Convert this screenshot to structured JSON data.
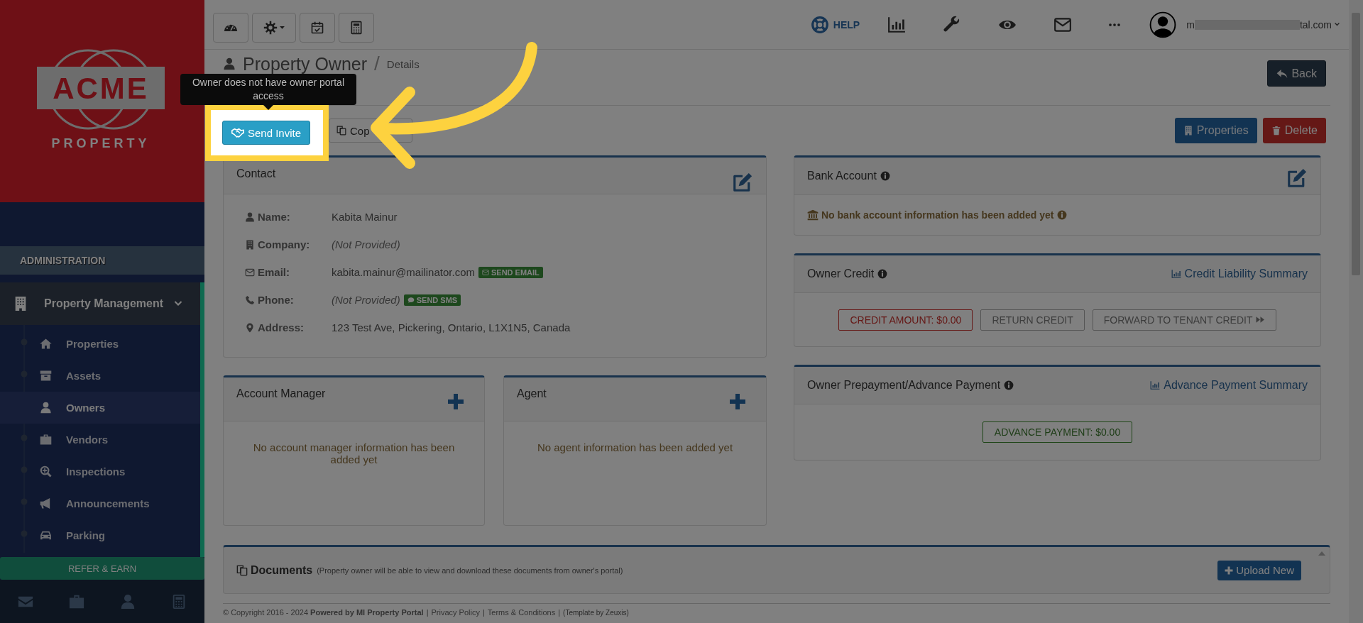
{
  "sidebar": {
    "logo": {
      "word": "ACME",
      "tagline": "PROPERTY"
    },
    "section": "ADMINISTRATION",
    "group": {
      "label": "Property Management",
      "expanded": true,
      "items": [
        {
          "label": "Properties",
          "selected": false
        },
        {
          "label": "Assets",
          "selected": false
        },
        {
          "label": "Owners",
          "selected": true
        },
        {
          "label": "Vendors",
          "selected": false
        },
        {
          "label": "Inspections",
          "selected": false
        },
        {
          "label": "Announcements",
          "selected": false
        },
        {
          "label": "Parking",
          "selected": false
        }
      ]
    },
    "refer": "REFER & EARN"
  },
  "topbar": {
    "help": "HELP",
    "user": {
      "email_start": "m",
      "email_end": "tal.com"
    }
  },
  "header": {
    "title": "Property Owner",
    "separator": "/",
    "subtitle": "Details",
    "back": "Back"
  },
  "tooltip": "Owner does not have owner portal access",
  "actions": {
    "send_invite": "Send Invite",
    "copy": "Cop",
    "properties": "Properties",
    "delete": "Delete"
  },
  "contact": {
    "title": "Contact",
    "fields": [
      {
        "label": "Name:",
        "value": "Kabita Mainur",
        "empty": false
      },
      {
        "label": "Company:",
        "value": "(Not Provided)",
        "empty": true
      },
      {
        "label": "Email:",
        "value": "kabita.mainur@mailinator.com",
        "empty": false,
        "action": {
          "kind": "email",
          "label": "SEND EMAIL"
        }
      },
      {
        "label": "Phone:",
        "value": "(Not Provided)",
        "empty": true,
        "action": {
          "kind": "sms",
          "label": "SEND SMS"
        }
      },
      {
        "label": "Address:",
        "value": "123 Test Ave, Pickering, Ontario, L1X1N5, Canada",
        "empty": false
      }
    ]
  },
  "account_manager": {
    "title": "Account Manager",
    "empty_text": "No account manager information has been added yet"
  },
  "agent": {
    "title": "Agent",
    "empty_text": "No agent information has been added yet"
  },
  "bank": {
    "title": "Bank Account",
    "empty_text": "No bank account information has been added yet"
  },
  "credit": {
    "title": "Owner Credit",
    "link": "Credit Liability Summary",
    "buttons": [
      {
        "kind": "amount",
        "label": "CREDIT AMOUNT: $0.00",
        "disabled": false
      },
      {
        "kind": "action",
        "label": "RETURN CREDIT",
        "disabled": true
      },
      {
        "kind": "forward",
        "label": "FORWARD TO TENANT CREDIT",
        "disabled": true
      }
    ]
  },
  "prepayment": {
    "title": "Owner Prepayment/Advance Payment",
    "link": "Advance Payment Summary",
    "amount": "ADVANCE PAYMENT: $0.00"
  },
  "documents": {
    "title": "Documents",
    "note": "(Property owner will be able to view and download these documents from owner's portal)",
    "upload": "Upload New"
  },
  "footer": {
    "copyright": "© Copyright 2016 - 2024 **Powered by MI Property Portal**",
    "separator": "|",
    "links": [
      "Privacy Policy",
      "Terms & Conditions"
    ],
    "template": "(Template by Zeuxis)"
  }
}
